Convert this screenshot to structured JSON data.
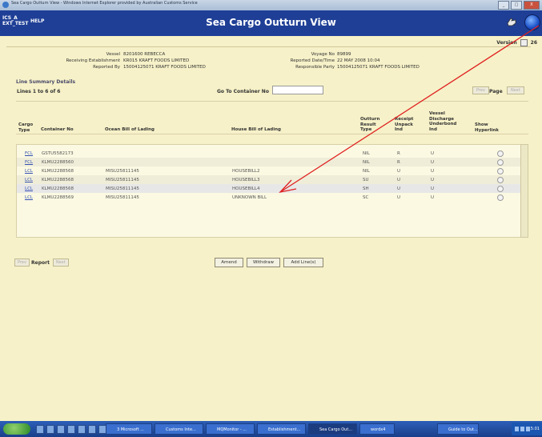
{
  "window": {
    "title": "Sea Cargo Outturn View - Windows Internet Explorer provided by Australian Customs Service",
    "buttons": [
      "_",
      "□",
      "X"
    ]
  },
  "header": {
    "logo_line1": "ICS_A",
    "logo_line2": "EXT_TEST",
    "help": "HELP",
    "title": "Sea Cargo Outturn View",
    "icons": [
      "hand-icon",
      "globe-icon"
    ]
  },
  "version": {
    "label": "Version",
    "value": "26"
  },
  "details": {
    "vessel": {
      "label": "Vessel",
      "value": "8201600 REBECCA"
    },
    "voyage": {
      "label": "Voyage No",
      "value": "89899"
    },
    "receiving": {
      "label": "Receiving Establishment",
      "value": "KR015 KRAFT FOODS LIMITED"
    },
    "reported_dt": {
      "label": "Reported Date/Time",
      "value": "22 MAY 2008 10:04"
    },
    "reported_by": {
      "label": "Reported By",
      "value": "15004125071 KRAFT FOODS LIMITED"
    },
    "responsible": {
      "label": "Responsible Party",
      "value": "15004125071 KRAFT FOODS LIMITED"
    }
  },
  "summary": {
    "heading": "Line Summary Details",
    "lines": "Lines 1 to 6 of 6",
    "goto_label": "Go To Container No",
    "prev": "Prev",
    "page": "Page",
    "next": "Next"
  },
  "table": {
    "headers": {
      "cargo1": "Cargo",
      "cargo2": "Type",
      "container": "Container No",
      "obl": "Ocean Bill of Lading",
      "hbl": "House Bill of Lading",
      "out1": "Outturn",
      "out2": "Result",
      "out3": "Type",
      "rec1": "Receipt",
      "rec2": "Unpack",
      "rec3": "Ind",
      "ves1": "Vessel",
      "ves2": "Discharge",
      "ves3": "Underbond",
      "ves4": "Ind",
      "show1": "Show",
      "show2": "Hyperlink"
    },
    "rows": [
      {
        "type": "FCL",
        "container": "GSTU5582173",
        "obl": "",
        "hbl": "",
        "result": "NIL",
        "receipt": "R",
        "vessel": "U"
      },
      {
        "type": "FCL",
        "container": "KLMU2288560",
        "obl": "",
        "hbl": "",
        "result": "NIL",
        "receipt": "R",
        "vessel": "U"
      },
      {
        "type": "LCL",
        "container": "KLMU2288568",
        "obl": "MISU25811145",
        "hbl": "HOUSEBILL2",
        "result": "NIL",
        "receipt": "U",
        "vessel": "U"
      },
      {
        "type": "LCL",
        "container": "KLMU2288568",
        "obl": "MISU25811145",
        "hbl": "HOUSEBILL3",
        "result": "SU",
        "receipt": "U",
        "vessel": "U"
      },
      {
        "type": "LCL",
        "container": "KLMU2288568",
        "obl": "MISU25811145",
        "hbl": "HOUSEBILL4",
        "result": "SH",
        "receipt": "U",
        "vessel": "U"
      },
      {
        "type": "LCL",
        "container": "KLMU2288569",
        "obl": "MISU25811145",
        "hbl": "UNKNOWN BILL",
        "result": "SC",
        "receipt": "U",
        "vessel": "U"
      }
    ]
  },
  "footer": {
    "prev": "Prev",
    "report": "Report",
    "next": "Next",
    "amend": "Amend",
    "withdraw": "Withdraw",
    "add_lines": "Add Line(s)"
  },
  "taskbar": {
    "items": [
      "3 Microsoft ...",
      "Customs Inte...",
      "MQMonitor - ...",
      "Establishment...",
      "Sea Cargo Out...",
      "wordx4",
      "Guide to Out..."
    ],
    "clock": "15:01"
  },
  "colors": {
    "header": "#1f3f96",
    "page": "#f6f1c8",
    "arrow": "#e02020"
  }
}
